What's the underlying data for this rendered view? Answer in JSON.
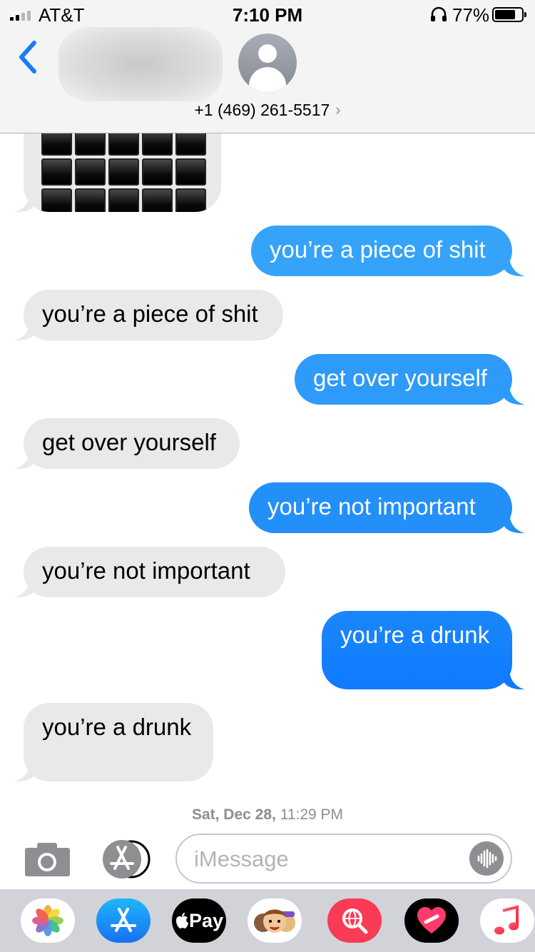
{
  "status_bar": {
    "carrier": "AT&T",
    "time": "7:10 PM",
    "battery_percent": "77%",
    "battery_level": 0.77,
    "signal_bars": 2
  },
  "header": {
    "contact": "+1 (469) 261-5517",
    "chevron": "›",
    "back_icon": "chevron-left-icon",
    "avatar_icon": "person-icon"
  },
  "colors": {
    "accent": "#1a7cf5",
    "incoming": "#e9e9eb",
    "outgoing_top": "#35a6f9",
    "outgoing_bottom": "#107aff"
  },
  "messages": [
    {
      "sender": "me",
      "text": "you’re a piece of shit"
    },
    {
      "sender": "them",
      "text": "you’re a piece of shit"
    },
    {
      "sender": "me",
      "text": "get over yourself"
    },
    {
      "sender": "them",
      "text": "get over yourself"
    },
    {
      "sender": "me",
      "text": "you’re not important"
    },
    {
      "sender": "them",
      "text": "you’re not important"
    },
    {
      "sender": "me",
      "text": "you’re a drunk"
    },
    {
      "sender": "them",
      "text": "you’re a drunk"
    }
  ],
  "timestamp": {
    "day": "Sat, Dec 28,",
    "time": " 11:29 PM"
  },
  "input": {
    "placeholder": "iMessage"
  },
  "apps": {
    "photos": "photos-icon",
    "app_store": "app-store-icon",
    "apple_pay": "Pay",
    "memoji": "memoji-icon",
    "web_search": "web-search-icon",
    "heart_app": "broken-heart-icon",
    "music": "music-icon"
  }
}
